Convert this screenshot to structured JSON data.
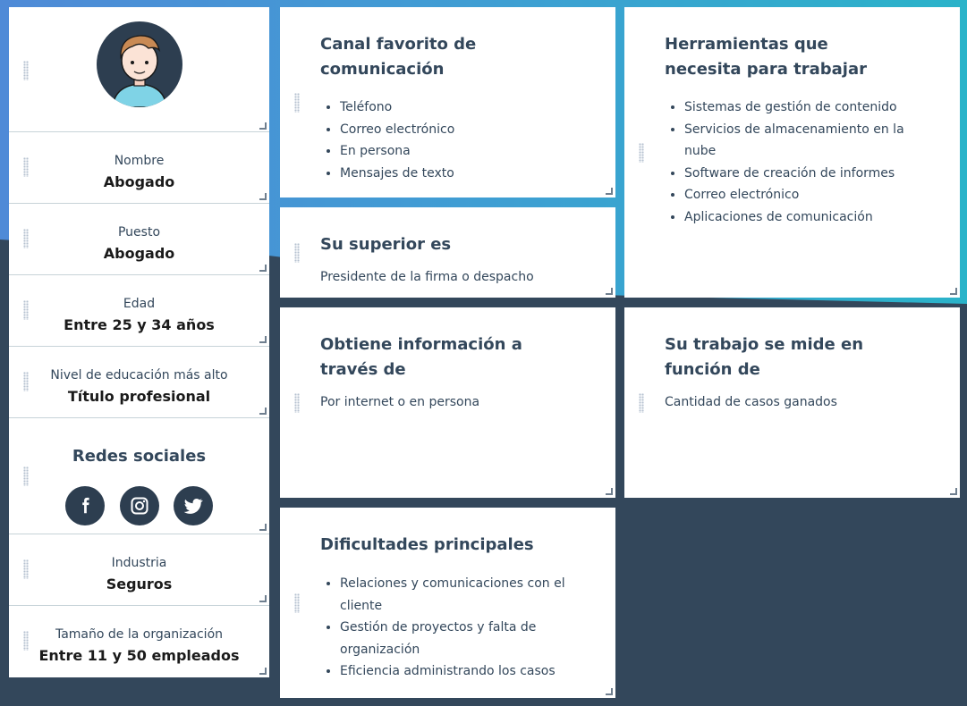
{
  "profile": {
    "name_label": "Nombre",
    "name_value": "Abogado",
    "job_label": "Puesto",
    "job_value": "Abogado",
    "age_label": "Edad",
    "age_value": "Entre 25 y 34 años",
    "education_label": "Nivel de educación más alto",
    "education_value": "Título profesional",
    "social_title": "Redes sociales",
    "social_icons": [
      "facebook-icon",
      "instagram-icon",
      "twitter-icon"
    ],
    "industry_label": "Industria",
    "industry_value": "Seguros",
    "org_size_label": "Tamaño de la organización",
    "org_size_value": "Entre 11 y 50 empleados"
  },
  "channel": {
    "title": "Canal favorito de comunicación",
    "items": [
      "Teléfono",
      "Correo electrónico",
      "En persona",
      "Mensajes de texto"
    ]
  },
  "tools": {
    "title": "Herramientas que necesita para trabajar",
    "items": [
      "Sistemas de gestión de contenido",
      "Servicios de almacenamiento en la nube",
      "Software de creación de informes",
      "Correo electrónico",
      "Aplicaciones de comunicación"
    ]
  },
  "superior": {
    "title": "Su superior es",
    "text": "Presidente de la firma o despacho"
  },
  "info": {
    "title": "Obtiene información a través de",
    "text": "Por internet o en persona"
  },
  "measured": {
    "title": "Su trabajo se mide en función de",
    "text": "Cantidad de casos ganados"
  },
  "challenges": {
    "title": "Dificultades principales",
    "items": [
      "Relaciones y comunicaciones con el cliente",
      "Gestión de proyectos y falta de organización",
      "Eficiencia administrando los casos"
    ]
  },
  "colors": {
    "dark": "#33475b",
    "gradient_start": "#4f8ad7",
    "gradient_end": "#2ab3c9"
  }
}
